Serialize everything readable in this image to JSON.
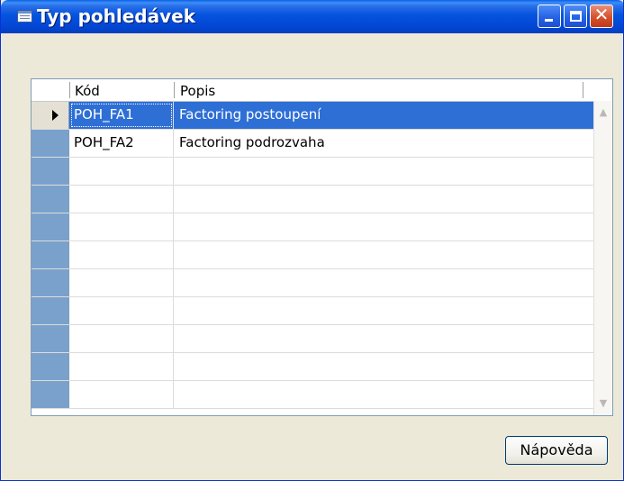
{
  "window": {
    "title": "Typ pohledávek",
    "title_icon": "table-icon"
  },
  "controls": {
    "minimize": "minimize-icon",
    "maximize": "maximize-icon",
    "close": "close-icon",
    "close_glyph": "✕"
  },
  "table": {
    "columns": [
      "Kód",
      "Popis"
    ],
    "rows": [
      {
        "kod": "POH_FA1",
        "popis": "Factoring postoupení",
        "selected": true
      },
      {
        "kod": "POH_FA2",
        "popis": "Factoring podrozvaha",
        "selected": false
      },
      {
        "kod": "",
        "popis": ""
      },
      {
        "kod": "",
        "popis": ""
      },
      {
        "kod": "",
        "popis": ""
      },
      {
        "kod": "",
        "popis": ""
      },
      {
        "kod": "",
        "popis": ""
      },
      {
        "kod": "",
        "popis": ""
      },
      {
        "kod": "",
        "popis": ""
      },
      {
        "kod": "",
        "popis": ""
      },
      {
        "kod": "",
        "popis": ""
      }
    ]
  },
  "buttons": {
    "help": "Nápověda"
  },
  "colors": {
    "selection": "#2e6fd6",
    "titlebar": "#0453df"
  }
}
